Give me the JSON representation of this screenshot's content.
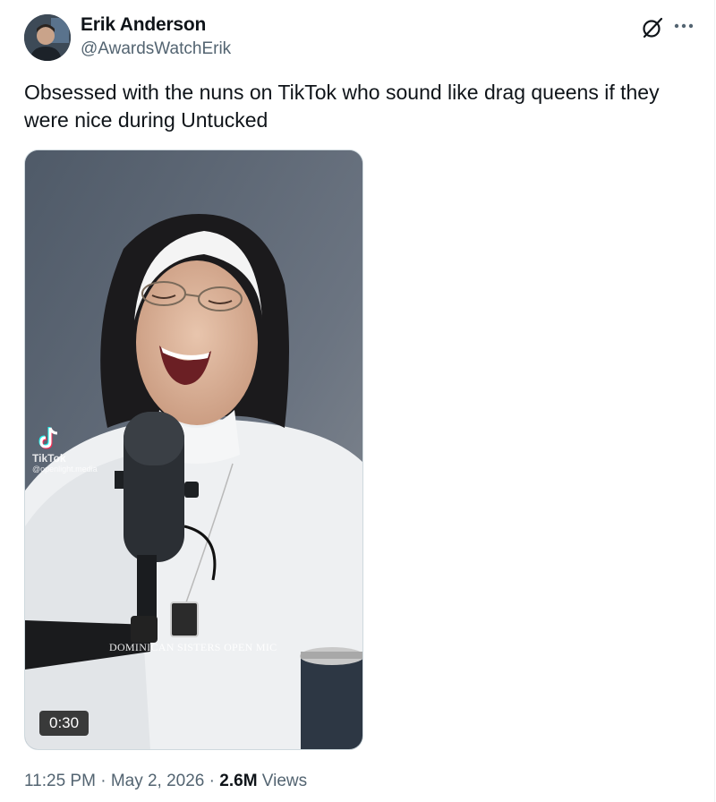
{
  "author": {
    "name": "Erik Anderson",
    "handle": "@AwardsWatchErik"
  },
  "icons": {
    "grok": "grok-icon",
    "more": "more-dots-icon",
    "tiktok": "tiktok-logo-icon"
  },
  "tweet": {
    "text": "Obsessed with the nuns on TikTok who sound like drag queens if they were nice during Untucked"
  },
  "media": {
    "watermark_brand": "TikTok",
    "watermark_handle": "@openlight.media",
    "caption_overlay": "DOMINICAN SISTERS OPEN MIC",
    "duration": "0:30"
  },
  "meta": {
    "time": "11:25 PM",
    "sep1": " · ",
    "date": "May 2, 2026",
    "sep2": " · ",
    "views_count": "2.6M",
    "views_label": " Views"
  },
  "colors": {
    "text_primary": "#0f1419",
    "text_secondary": "#536471",
    "border": "#cfd9de"
  }
}
